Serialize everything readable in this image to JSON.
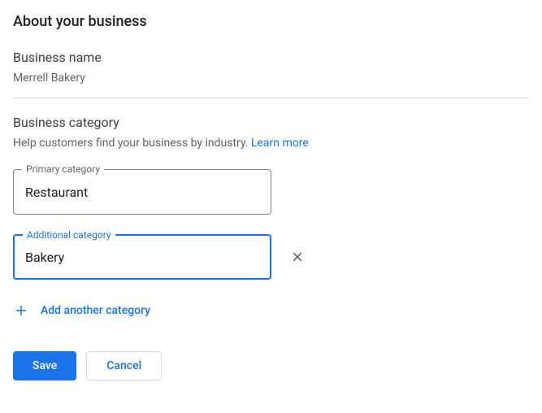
{
  "page": {
    "title": "About your business"
  },
  "businessName": {
    "label": "Business name",
    "value": "Merrell Bakery"
  },
  "businessCategory": {
    "label": "Business category",
    "helpText": "Help customers find your business by industry. ",
    "learnMore": "Learn more"
  },
  "primaryCategory": {
    "label": "Primary category",
    "value": "Restaurant"
  },
  "additionalCategory": {
    "label": "Additional category",
    "value": "Bakery"
  },
  "addAnother": {
    "label": "Add another category"
  },
  "buttons": {
    "save": "Save",
    "cancel": "Cancel"
  }
}
